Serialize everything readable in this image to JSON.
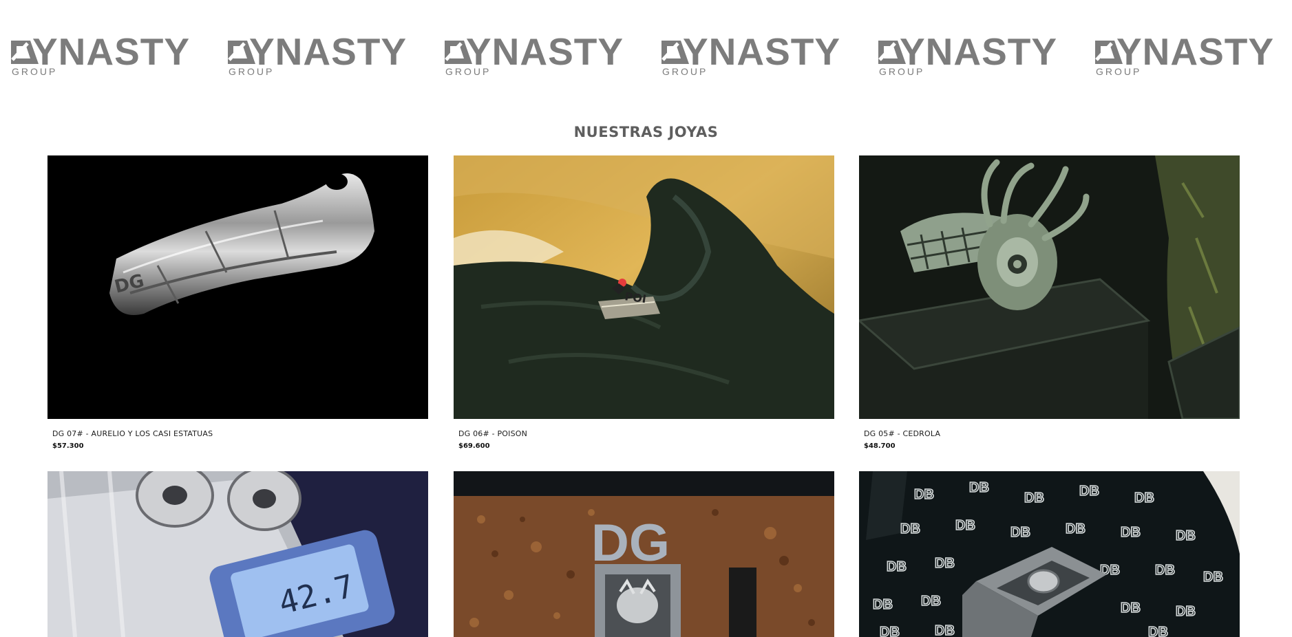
{
  "brand": {
    "logo_word": "YNASTY",
    "logo_sub": "GROUP",
    "logo_repeat_count_visible": 6,
    "color": "#7c7c7c"
  },
  "section": {
    "title": "NUESTRAS JOYAS"
  },
  "products": [
    {
      "name": "DG 07# - AURELIO Y LOS CASI ESTATUAS",
      "price": "$57.300",
      "image": "silver-ring-black-background"
    },
    {
      "name": "DG 06# - POISON",
      "price": "$69.600",
      "image": "gloved-hand-holding-ring"
    },
    {
      "name": "DG 05# - CEDROLA",
      "price": "$48.700",
      "image": "spider-ring-in-box"
    },
    {
      "name": "",
      "price": "",
      "image": "rings-on-digital-scale"
    },
    {
      "name": "",
      "price": "",
      "image": "ring-on-rust-with-dg-logo"
    },
    {
      "name": "",
      "price": "",
      "image": "signet-ring-on-monogram-fabric"
    }
  ],
  "scale_readout": "42.7",
  "colors": {
    "background": "#ffffff",
    "title": "#5e5e5e",
    "text": "#1b1b1b"
  }
}
